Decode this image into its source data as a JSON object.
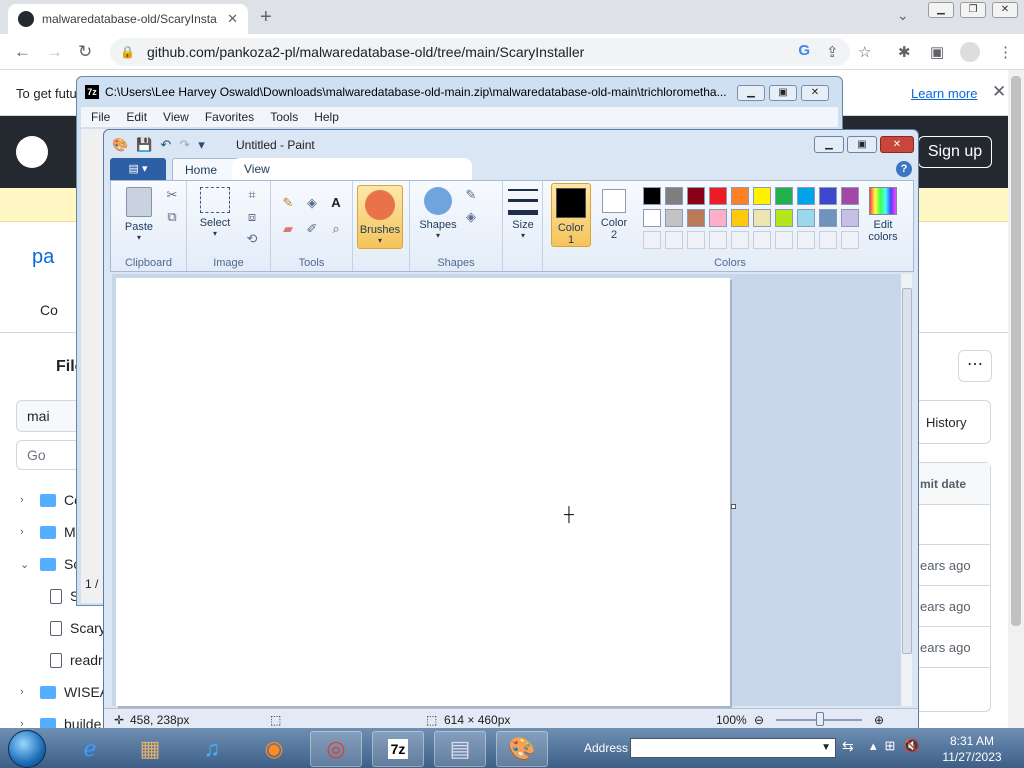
{
  "browser": {
    "tab_title": "malwaredatabase-old/ScaryInsta",
    "url": "github.com/pankoza2-pl/malwaredatabase-old/tree/main/ScaryInstaller"
  },
  "github": {
    "banner_text": "To get futu",
    "learn_more": "Learn more",
    "sign_up": "Sign up",
    "repo_name": "pa",
    "code_tab": "Co",
    "files_heading": "File",
    "branch": "mai",
    "go_placeholder": "Go",
    "tree": [
      {
        "type": "folder",
        "label": "Co",
        "expanded": false
      },
      {
        "type": "folder",
        "label": "M",
        "expanded": false
      },
      {
        "type": "folder",
        "label": "Sc",
        "expanded": true
      },
      {
        "type": "file",
        "label": "S"
      },
      {
        "type": "file",
        "label": "Scary"
      },
      {
        "type": "file",
        "label": "readr"
      },
      {
        "type": "folder",
        "label": "WISEA",
        "expanded": false
      },
      {
        "type": "folder",
        "label": "builde",
        "expanded": false
      }
    ],
    "history": "History",
    "commit_date_header": "mit date",
    "rows": [
      "ears ago",
      "ears ago",
      "ears ago"
    ]
  },
  "sevenzip": {
    "title": "C:\\Users\\Lee Harvey Oswald\\Downloads\\malwaredatabase-old-main.zip\\malwaredatabase-old-main\\trichlorometha...",
    "menu": [
      "File",
      "Edit",
      "View",
      "Favorites",
      "Tools",
      "Help"
    ],
    "status": "1 /"
  },
  "paint": {
    "title": "Untitled - Paint",
    "tabs": [
      "Home",
      "View"
    ],
    "groups": {
      "clipboard": "Clipboard",
      "image": "Image",
      "tools": "Tools",
      "shapes": "Shapes",
      "colors": "Colors"
    },
    "buttons": {
      "paste": "Paste",
      "select": "Select",
      "brushes": "Brushes",
      "shapes": "Shapes",
      "size": "Size",
      "color1": "Color\n1",
      "color2": "Color\n2",
      "edit_colors": "Edit\ncolors"
    },
    "palette_row1": [
      "#000000",
      "#7f7f7f",
      "#880015",
      "#ed1c24",
      "#ff7f27",
      "#fff200",
      "#22b14c",
      "#00a2e8",
      "#3f48cc",
      "#a349a4"
    ],
    "palette_row2": [
      "#ffffff",
      "#c3c3c3",
      "#b97a57",
      "#ffaec9",
      "#ffc90e",
      "#efe4b0",
      "#b5e61d",
      "#99d9ea",
      "#7092be",
      "#c8bfe7"
    ],
    "color1": "#000000",
    "color2": "#ffffff",
    "status": {
      "cursor_pos": "458, 238px",
      "canvas_size": "614 × 460px",
      "zoom": "100%"
    }
  },
  "taskbar": {
    "address_label": "Address",
    "time": "8:31 AM",
    "date": "11/27/2023"
  }
}
